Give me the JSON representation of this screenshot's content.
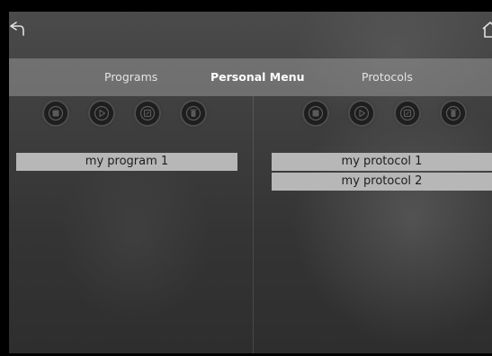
{
  "tabs": {
    "programs": "Programs",
    "personal_menu": "Personal Menu",
    "protocols": "Protocols",
    "active": "personal_menu"
  },
  "programs_toolbar": [
    {
      "icon": "stop-icon"
    },
    {
      "icon": "play-icon"
    },
    {
      "icon": "edit-icon"
    },
    {
      "icon": "delete-icon"
    }
  ],
  "protocols_toolbar": [
    {
      "icon": "stop-icon"
    },
    {
      "icon": "play-icon"
    },
    {
      "icon": "edit-icon"
    },
    {
      "icon": "delete-icon"
    }
  ],
  "programs_list": [
    "my program 1"
  ],
  "protocols_list": [
    "my protocol 1",
    "my protocol 2"
  ],
  "colors": {
    "tabbar": "#8f8f8f",
    "list_item_bg": "#b7b7b7",
    "list_item_text": "#1d1d1d",
    "icon_button_bg": "#1e1e1e"
  }
}
